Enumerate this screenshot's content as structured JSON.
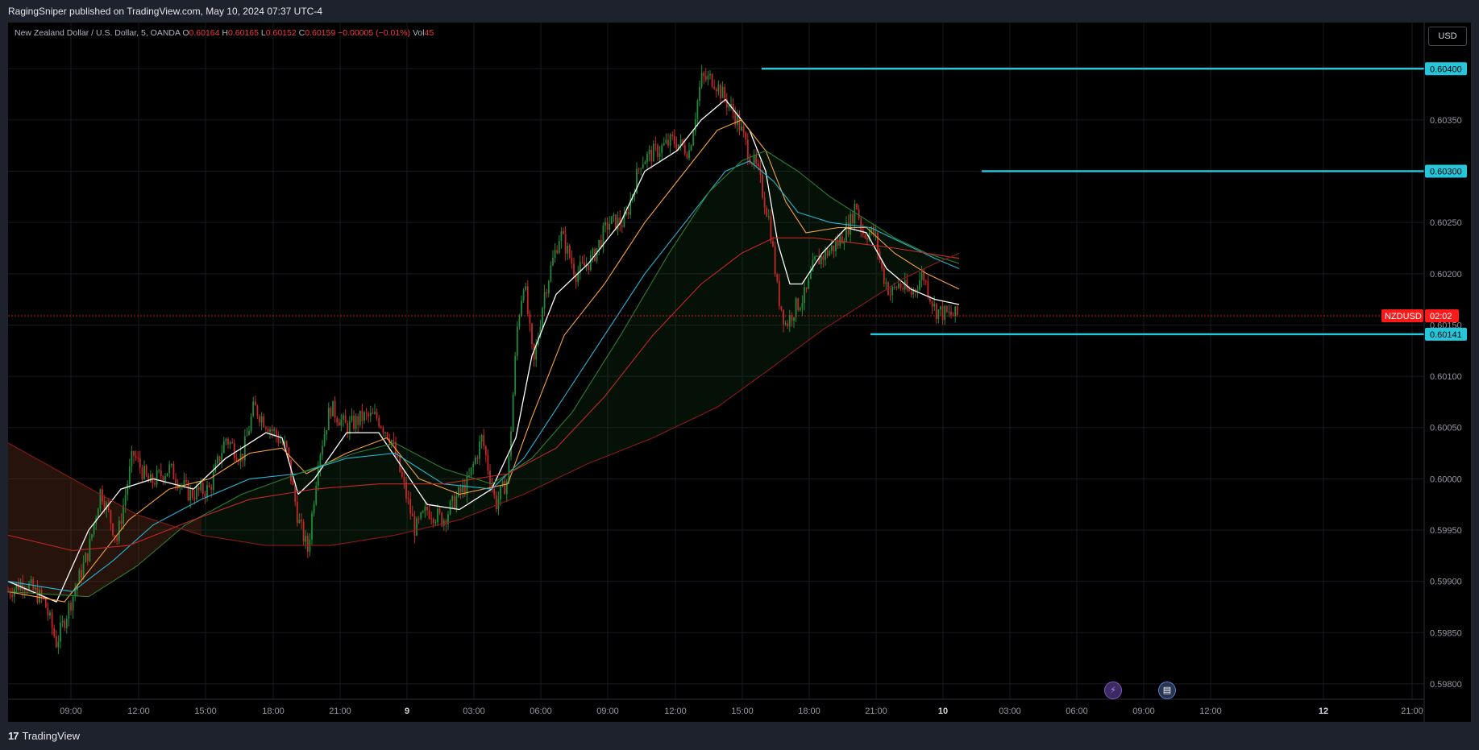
{
  "header": {
    "published_text": "RagingSniper published on TradingView.com, May 10, 2024 07:37 UTC-4"
  },
  "legend": {
    "symbol": "New Zealand Dollar / U.S. Dollar, 5, OANDA",
    "o_label": "O",
    "o_value": "0.60164",
    "h_label": "H",
    "h_value": "0.60165",
    "l_label": "L",
    "l_value": "0.60152",
    "c_label": "C",
    "c_value": "0.60159",
    "change": "−0.00005 (−0.01%)",
    "vol_label": "Vol",
    "vol_value": "45"
  },
  "currency_button": "USD",
  "footer": {
    "brand": "TradingView"
  },
  "events": {
    "event1_icon": "lightning-icon",
    "event2_icon": "us-flag-icon"
  },
  "colors": {
    "bull": "#26a69a",
    "bull_dark": "#1b7a3a",
    "bear": "#f23645",
    "ma_white": "#ffffff",
    "ma_orange": "#f7a23b",
    "ma_cyan": "#27b5d6",
    "ma_green": "#2e7d32",
    "ma_red": "#c62828",
    "level_line": "#26c6da",
    "price_tag": "#ff1a1a"
  },
  "chart_data": {
    "type": "candlestick",
    "symbol": "NZDUSD",
    "timeframe": "5",
    "y_axis": {
      "ticks": [
        "0.60400",
        "0.60350",
        "0.60300",
        "0.60250",
        "0.60200",
        "0.60150",
        "0.60100",
        "0.60050",
        "0.60000",
        "0.59950",
        "0.59900",
        "0.59850",
        "0.59800"
      ],
      "ylim": [
        0.59785,
        0.60445
      ]
    },
    "x_axis": {
      "ticks": [
        "09:00",
        "12:00",
        "15:00",
        "18:00",
        "21:00",
        "9",
        "03:00",
        "06:00",
        "09:00",
        "12:00",
        "15:00",
        "18:00",
        "21:00",
        "10",
        "03:00",
        "06:00",
        "09:00",
        "12:00",
        "12",
        "21:00"
      ]
    },
    "current_price": {
      "label": "NZDUSD",
      "timer": "02:02",
      "value": 0.60159
    },
    "horizontal_levels": [
      {
        "value": 0.604,
        "label": "0.60400"
      },
      {
        "value": 0.603,
        "label": "0.60300"
      },
      {
        "value": 0.60141,
        "label": "0.60141"
      }
    ],
    "price_path": [
      [
        0,
        0.5989
      ],
      [
        20,
        0.599
      ],
      [
        45,
        0.5988
      ],
      [
        60,
        0.5984
      ],
      [
        80,
        0.59885
      ],
      [
        100,
        0.5993
      ],
      [
        115,
        0.5999
      ],
      [
        135,
        0.5994
      ],
      [
        155,
        0.60025
      ],
      [
        175,
        0.59995
      ],
      [
        200,
        0.6001
      ],
      [
        225,
        0.59985
      ],
      [
        250,
        0.5999
      ],
      [
        270,
        0.6004
      ],
      [
        290,
        0.6002
      ],
      [
        305,
        0.6007
      ],
      [
        325,
        0.6005
      ],
      [
        345,
        0.6003
      ],
      [
        360,
        0.5996
      ],
      [
        372,
        0.5993
      ],
      [
        385,
        0.6002
      ],
      [
        400,
        0.6007
      ],
      [
        420,
        0.6005
      ],
      [
        440,
        0.6006
      ],
      [
        458,
        0.6006
      ],
      [
        475,
        0.6004
      ],
      [
        492,
        0.5999
      ],
      [
        505,
        0.5995
      ],
      [
        520,
        0.5997
      ],
      [
        540,
        0.5996
      ],
      [
        555,
        0.5998
      ],
      [
        570,
        0.59995
      ],
      [
        588,
        0.6004
      ],
      [
        605,
        0.59975
      ],
      [
        620,
        0.6
      ],
      [
        632,
        0.6015
      ],
      [
        640,
        0.60195
      ],
      [
        652,
        0.6011
      ],
      [
        665,
        0.6018
      ],
      [
        685,
        0.6024
      ],
      [
        705,
        0.602
      ],
      [
        725,
        0.60215
      ],
      [
        745,
        0.6025
      ],
      [
        765,
        0.6025
      ],
      [
        785,
        0.6031
      ],
      [
        805,
        0.6032
      ],
      [
        825,
        0.6033
      ],
      [
        845,
        0.6032
      ],
      [
        860,
        0.6039
      ],
      [
        875,
        0.6039
      ],
      [
        890,
        0.6037
      ],
      [
        905,
        0.6035
      ],
      [
        918,
        0.6032
      ],
      [
        930,
        0.603
      ],
      [
        945,
        0.6025
      ],
      [
        955,
        0.6018
      ],
      [
        965,
        0.6015
      ],
      [
        975,
        0.60165
      ],
      [
        990,
        0.6018
      ],
      [
        1000,
        0.6021
      ],
      [
        1015,
        0.6022
      ],
      [
        1030,
        0.6023
      ],
      [
        1045,
        0.6025
      ],
      [
        1052,
        0.6027
      ],
      [
        1060,
        0.6024
      ],
      [
        1075,
        0.6024
      ],
      [
        1085,
        0.602
      ],
      [
        1095,
        0.6018
      ],
      [
        1105,
        0.6019
      ],
      [
        1120,
        0.6018
      ],
      [
        1135,
        0.602
      ],
      [
        1150,
        0.60165
      ],
      [
        1165,
        0.6016
      ],
      [
        1180,
        0.60159
      ]
    ],
    "moving_averages": [
      {
        "color": "#ffffff",
        "points": [
          [
            0,
            0.599
          ],
          [
            60,
            0.5988
          ],
          [
            100,
            0.5995
          ],
          [
            140,
            0.5999
          ],
          [
            180,
            0.6
          ],
          [
            230,
            0.5999
          ],
          [
            270,
            0.6002
          ],
          [
            320,
            0.60045
          ],
          [
            340,
            0.6004
          ],
          [
            360,
            0.59985
          ],
          [
            380,
            0.6
          ],
          [
            420,
            0.60045
          ],
          [
            460,
            0.60045
          ],
          [
            490,
            0.6001
          ],
          [
            520,
            0.59975
          ],
          [
            560,
            0.5997
          ],
          [
            600,
            0.5999
          ],
          [
            630,
            0.6004
          ],
          [
            650,
            0.6012
          ],
          [
            680,
            0.6018
          ],
          [
            720,
            0.6021
          ],
          [
            760,
            0.6025
          ],
          [
            790,
            0.603
          ],
          [
            830,
            0.6032
          ],
          [
            860,
            0.6035
          ],
          [
            890,
            0.6037
          ],
          [
            920,
            0.6034
          ],
          [
            940,
            0.603
          ],
          [
            955,
            0.6023
          ],
          [
            970,
            0.6019
          ],
          [
            985,
            0.6019
          ],
          [
            1010,
            0.6022
          ],
          [
            1040,
            0.60245
          ],
          [
            1065,
            0.6024
          ],
          [
            1090,
            0.60205
          ],
          [
            1120,
            0.60185
          ],
          [
            1150,
            0.60175
          ],
          [
            1180,
            0.6017
          ]
        ]
      },
      {
        "color": "#f7a23b",
        "points": [
          [
            0,
            0.5989
          ],
          [
            70,
            0.5988
          ],
          [
            110,
            0.5992
          ],
          [
            150,
            0.5996
          ],
          [
            200,
            0.5999
          ],
          [
            250,
            0.6
          ],
          [
            300,
            0.60025
          ],
          [
            340,
            0.6003
          ],
          [
            370,
            0.60005
          ],
          [
            420,
            0.60025
          ],
          [
            470,
            0.6004
          ],
          [
            510,
            0.6
          ],
          [
            560,
            0.59985
          ],
          [
            620,
            0.59995
          ],
          [
            650,
            0.6006
          ],
          [
            690,
            0.6014
          ],
          [
            740,
            0.6019
          ],
          [
            790,
            0.6025
          ],
          [
            840,
            0.603
          ],
          [
            880,
            0.6034
          ],
          [
            910,
            0.6035
          ],
          [
            940,
            0.6032
          ],
          [
            965,
            0.6027
          ],
          [
            990,
            0.6024
          ],
          [
            1030,
            0.60245
          ],
          [
            1065,
            0.60245
          ],
          [
            1100,
            0.6022
          ],
          [
            1140,
            0.602
          ],
          [
            1180,
            0.60185
          ]
        ]
      },
      {
        "color": "#27b5d6",
        "points": [
          [
            0,
            0.599
          ],
          [
            80,
            0.5989
          ],
          [
            130,
            0.5992
          ],
          [
            180,
            0.59955
          ],
          [
            240,
            0.5998
          ],
          [
            300,
            0.6
          ],
          [
            360,
            0.60005
          ],
          [
            420,
            0.6002
          ],
          [
            480,
            0.60025
          ],
          [
            540,
            0.59995
          ],
          [
            600,
            0.5999
          ],
          [
            640,
            0.6002
          ],
          [
            690,
            0.6008
          ],
          [
            740,
            0.6014
          ],
          [
            790,
            0.602
          ],
          [
            840,
            0.6025
          ],
          [
            890,
            0.603
          ],
          [
            920,
            0.6031
          ],
          [
            950,
            0.6029
          ],
          [
            980,
            0.6026
          ],
          [
            1020,
            0.6025
          ],
          [
            1070,
            0.60245
          ],
          [
            1110,
            0.6023
          ],
          [
            1150,
            0.60215
          ],
          [
            1180,
            0.60205
          ]
        ]
      },
      {
        "color": "#2e7d32",
        "points": [
          [
            0,
            0.5989
          ],
          [
            100,
            0.59885
          ],
          [
            160,
            0.59915
          ],
          [
            220,
            0.59955
          ],
          [
            290,
            0.59985
          ],
          [
            360,
            0.60005
          ],
          [
            430,
            0.60025
          ],
          [
            480,
            0.60035
          ],
          [
            540,
            0.6001
          ],
          [
            600,
            0.59995
          ],
          [
            650,
            0.6002
          ],
          [
            700,
            0.60065
          ],
          [
            760,
            0.6014
          ],
          [
            820,
            0.6022
          ],
          [
            870,
            0.6028
          ],
          [
            910,
            0.6031
          ],
          [
            940,
            0.6032
          ],
          [
            980,
            0.603
          ],
          [
            1020,
            0.60275
          ],
          [
            1060,
            0.60255
          ],
          [
            1100,
            0.60235
          ],
          [
            1140,
            0.6022
          ],
          [
            1180,
            0.6021
          ]
        ]
      },
      {
        "color": "#c62828",
        "points": [
          [
            0,
            0.59945
          ],
          [
            80,
            0.5993
          ],
          [
            150,
            0.59935
          ],
          [
            230,
            0.5996
          ],
          [
            300,
            0.5998
          ],
          [
            380,
            0.5999
          ],
          [
            460,
            0.59995
          ],
          [
            540,
            0.59995
          ],
          [
            620,
            0.60005
          ],
          [
            680,
            0.6003
          ],
          [
            740,
            0.6008
          ],
          [
            800,
            0.6014
          ],
          [
            860,
            0.6019
          ],
          [
            910,
            0.6022
          ],
          [
            950,
            0.60235
          ],
          [
            1000,
            0.60235
          ],
          [
            1050,
            0.6023
          ],
          [
            1100,
            0.60225
          ],
          [
            1140,
            0.6022
          ],
          [
            1180,
            0.60215
          ]
        ]
      },
      {
        "color": "#8b1a1a",
        "points": [
          [
            0,
            0.60035
          ],
          [
            80,
            0.6
          ],
          [
            160,
            0.59965
          ],
          [
            240,
            0.59945
          ],
          [
            320,
            0.59935
          ],
          [
            400,
            0.59935
          ],
          [
            480,
            0.59945
          ],
          [
            560,
            0.5996
          ],
          [
            640,
            0.59985
          ],
          [
            720,
            0.60015
          ],
          [
            800,
            0.6004
          ],
          [
            880,
            0.6007
          ],
          [
            950,
            0.6011
          ],
          [
            1010,
            0.60145
          ],
          [
            1060,
            0.6017
          ],
          [
            1110,
            0.60195
          ],
          [
            1150,
            0.6021
          ],
          [
            1180,
            0.6022
          ]
        ]
      }
    ]
  }
}
